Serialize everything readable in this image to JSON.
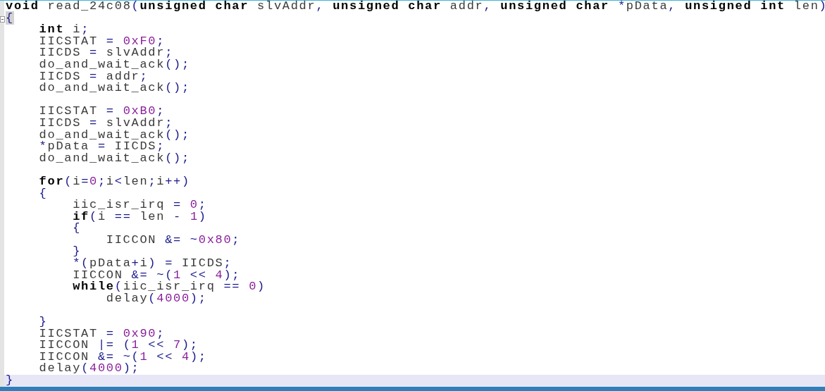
{
  "editor": {
    "lines": [
      {
        "fold": false,
        "current": false,
        "tokens": [
          {
            "kind": "kw",
            "text": "void"
          },
          {
            "kind": "id",
            "text": " read_24c08"
          },
          {
            "kind": "op",
            "text": "("
          },
          {
            "kind": "kw",
            "text": "unsigned char"
          },
          {
            "kind": "id",
            "text": " slvAddr"
          },
          {
            "kind": "op",
            "text": ", "
          },
          {
            "kind": "kw",
            "text": "unsigned char"
          },
          {
            "kind": "id",
            "text": " addr"
          },
          {
            "kind": "op",
            "text": ", "
          },
          {
            "kind": "kw",
            "text": "unsigned char"
          },
          {
            "kind": "op",
            "text": " *"
          },
          {
            "kind": "id",
            "text": "pData"
          },
          {
            "kind": "op",
            "text": ", "
          },
          {
            "kind": "kw",
            "text": "unsigned int"
          },
          {
            "kind": "id",
            "text": " len"
          },
          {
            "kind": "op",
            "text": ")"
          }
        ]
      },
      {
        "fold": true,
        "current": false,
        "tokens": [
          {
            "kind": "brace",
            "text": "{"
          }
        ]
      },
      {
        "fold": false,
        "current": false,
        "tokens": [
          {
            "kind": "kw",
            "text": "    int"
          },
          {
            "kind": "id",
            "text": " i"
          },
          {
            "kind": "op",
            "text": ";"
          }
        ]
      },
      {
        "fold": false,
        "current": false,
        "tokens": [
          {
            "kind": "id",
            "text": "    IICSTAT"
          },
          {
            "kind": "op",
            "text": " = "
          },
          {
            "kind": "num",
            "text": "0xF0"
          },
          {
            "kind": "op",
            "text": ";"
          }
        ]
      },
      {
        "fold": false,
        "current": false,
        "tokens": [
          {
            "kind": "id",
            "text": "    IICDS"
          },
          {
            "kind": "op",
            "text": " = "
          },
          {
            "kind": "id",
            "text": "slvAddr"
          },
          {
            "kind": "op",
            "text": ";"
          }
        ]
      },
      {
        "fold": false,
        "current": false,
        "tokens": [
          {
            "kind": "id",
            "text": "    do_and_wait_ack"
          },
          {
            "kind": "op",
            "text": "();"
          }
        ]
      },
      {
        "fold": false,
        "current": false,
        "tokens": [
          {
            "kind": "id",
            "text": "    IICDS"
          },
          {
            "kind": "op",
            "text": " = "
          },
          {
            "kind": "id",
            "text": "addr"
          },
          {
            "kind": "op",
            "text": ";"
          }
        ]
      },
      {
        "fold": false,
        "current": false,
        "tokens": [
          {
            "kind": "id",
            "text": "    do_and_wait_ack"
          },
          {
            "kind": "op",
            "text": "();"
          }
        ]
      },
      {
        "fold": false,
        "current": false
      },
      {
        "fold": false,
        "current": false,
        "tokens": [
          {
            "kind": "id",
            "text": "    IICSTAT"
          },
          {
            "kind": "op",
            "text": " = "
          },
          {
            "kind": "num",
            "text": "0xB0"
          },
          {
            "kind": "op",
            "text": ";"
          }
        ]
      },
      {
        "fold": false,
        "current": false,
        "tokens": [
          {
            "kind": "id",
            "text": "    IICDS"
          },
          {
            "kind": "op",
            "text": " = "
          },
          {
            "kind": "id",
            "text": "slvAddr"
          },
          {
            "kind": "op",
            "text": ";"
          }
        ]
      },
      {
        "fold": false,
        "current": false,
        "tokens": [
          {
            "kind": "id",
            "text": "    do_and_wait_ack"
          },
          {
            "kind": "op",
            "text": "();"
          }
        ]
      },
      {
        "fold": false,
        "current": false,
        "tokens": [
          {
            "kind": "op",
            "text": "    *"
          },
          {
            "kind": "id",
            "text": "pData"
          },
          {
            "kind": "op",
            "text": " = "
          },
          {
            "kind": "id",
            "text": "IICDS"
          },
          {
            "kind": "op",
            "text": ";"
          }
        ]
      },
      {
        "fold": false,
        "current": false,
        "tokens": [
          {
            "kind": "id",
            "text": "    do_and_wait_ack"
          },
          {
            "kind": "op",
            "text": "();"
          }
        ]
      },
      {
        "fold": false,
        "current": false
      },
      {
        "fold": false,
        "current": false,
        "tokens": [
          {
            "kind": "kw",
            "text": "    for"
          },
          {
            "kind": "op",
            "text": "("
          },
          {
            "kind": "id",
            "text": "i"
          },
          {
            "kind": "op",
            "text": "="
          },
          {
            "kind": "num",
            "text": "0"
          },
          {
            "kind": "op",
            "text": ";"
          },
          {
            "kind": "id",
            "text": "i"
          },
          {
            "kind": "op",
            "text": "<"
          },
          {
            "kind": "id",
            "text": "len"
          },
          {
            "kind": "op",
            "text": ";"
          },
          {
            "kind": "id",
            "text": "i"
          },
          {
            "kind": "op",
            "text": "++)"
          }
        ]
      },
      {
        "fold": false,
        "current": false,
        "tokens": [
          {
            "kind": "op",
            "text": "    {"
          }
        ]
      },
      {
        "fold": false,
        "current": false,
        "tokens": [
          {
            "kind": "id",
            "text": "        iic_isr_irq"
          },
          {
            "kind": "op",
            "text": " = "
          },
          {
            "kind": "num",
            "text": "0"
          },
          {
            "kind": "op",
            "text": ";"
          }
        ]
      },
      {
        "fold": false,
        "current": false,
        "tokens": [
          {
            "kind": "kw",
            "text": "        if"
          },
          {
            "kind": "op",
            "text": "("
          },
          {
            "kind": "id",
            "text": "i"
          },
          {
            "kind": "op",
            "text": " == "
          },
          {
            "kind": "id",
            "text": "len"
          },
          {
            "kind": "op",
            "text": " - "
          },
          {
            "kind": "num",
            "text": "1"
          },
          {
            "kind": "op",
            "text": ")"
          }
        ]
      },
      {
        "fold": false,
        "current": false,
        "tokens": [
          {
            "kind": "op",
            "text": "        {"
          }
        ]
      },
      {
        "fold": false,
        "current": false,
        "tokens": [
          {
            "kind": "id",
            "text": "            IICCON"
          },
          {
            "kind": "op",
            "text": " &= ~"
          },
          {
            "kind": "num",
            "text": "0x80"
          },
          {
            "kind": "op",
            "text": ";"
          }
        ]
      },
      {
        "fold": false,
        "current": false,
        "tokens": [
          {
            "kind": "op",
            "text": "        }"
          }
        ]
      },
      {
        "fold": false,
        "current": false,
        "tokens": [
          {
            "kind": "op",
            "text": "        *("
          },
          {
            "kind": "id",
            "text": "pData"
          },
          {
            "kind": "op",
            "text": "+"
          },
          {
            "kind": "id",
            "text": "i"
          },
          {
            "kind": "op",
            "text": ") = "
          },
          {
            "kind": "id",
            "text": "IICDS"
          },
          {
            "kind": "op",
            "text": ";"
          }
        ]
      },
      {
        "fold": false,
        "current": false,
        "tokens": [
          {
            "kind": "id",
            "text": "        IICCON"
          },
          {
            "kind": "op",
            "text": " &= ~("
          },
          {
            "kind": "num",
            "text": "1"
          },
          {
            "kind": "op",
            "text": " << "
          },
          {
            "kind": "num",
            "text": "4"
          },
          {
            "kind": "op",
            "text": ");"
          }
        ]
      },
      {
        "fold": false,
        "current": false,
        "tokens": [
          {
            "kind": "kw",
            "text": "        while"
          },
          {
            "kind": "op",
            "text": "("
          },
          {
            "kind": "id",
            "text": "iic_isr_irq"
          },
          {
            "kind": "op",
            "text": " == "
          },
          {
            "kind": "num",
            "text": "0"
          },
          {
            "kind": "op",
            "text": ")"
          }
        ]
      },
      {
        "fold": false,
        "current": false,
        "tokens": [
          {
            "kind": "id",
            "text": "            delay"
          },
          {
            "kind": "op",
            "text": "("
          },
          {
            "kind": "num",
            "text": "4000"
          },
          {
            "kind": "op",
            "text": ");"
          }
        ]
      },
      {
        "fold": false,
        "current": false
      },
      {
        "fold": false,
        "current": false,
        "tokens": [
          {
            "kind": "op",
            "text": "    }"
          }
        ]
      },
      {
        "fold": false,
        "current": false,
        "tokens": [
          {
            "kind": "id",
            "text": "    IICSTAT"
          },
          {
            "kind": "op",
            "text": " = "
          },
          {
            "kind": "num",
            "text": "0x90"
          },
          {
            "kind": "op",
            "text": ";"
          }
        ]
      },
      {
        "fold": false,
        "current": false,
        "tokens": [
          {
            "kind": "id",
            "text": "    IICCON"
          },
          {
            "kind": "op",
            "text": " |= ("
          },
          {
            "kind": "num",
            "text": "1"
          },
          {
            "kind": "op",
            "text": " << "
          },
          {
            "kind": "num",
            "text": "7"
          },
          {
            "kind": "op",
            "text": ");"
          }
        ]
      },
      {
        "fold": false,
        "current": false,
        "tokens": [
          {
            "kind": "id",
            "text": "    IICCON"
          },
          {
            "kind": "op",
            "text": " &= ~("
          },
          {
            "kind": "num",
            "text": "1"
          },
          {
            "kind": "op",
            "text": " << "
          },
          {
            "kind": "num",
            "text": "4"
          },
          {
            "kind": "op",
            "text": ");"
          }
        ]
      },
      {
        "fold": false,
        "current": false,
        "tokens": [
          {
            "kind": "id",
            "text": "    delay"
          },
          {
            "kind": "op",
            "text": "("
          },
          {
            "kind": "num",
            "text": "4000"
          },
          {
            "kind": "op",
            "text": ");"
          }
        ]
      },
      {
        "fold": false,
        "current": true,
        "tokens": [
          {
            "kind": "op",
            "text": "}"
          }
        ]
      }
    ]
  }
}
